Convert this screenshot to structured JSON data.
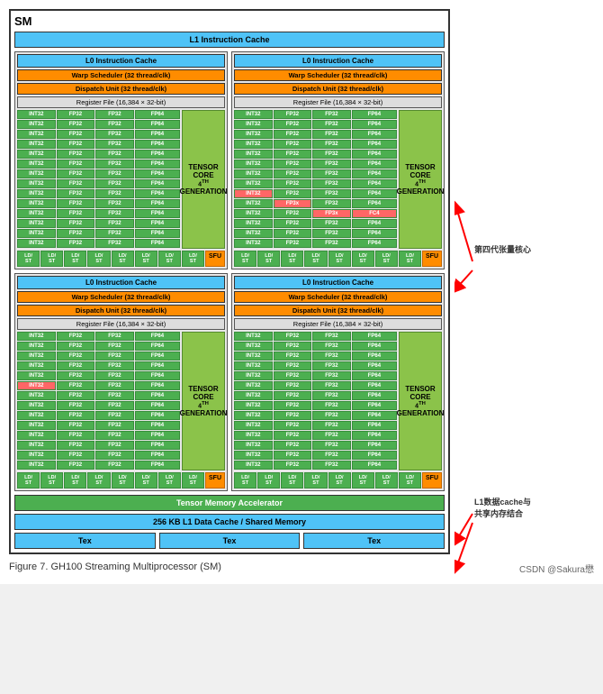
{
  "sm_title": "SM",
  "l1_cache": "L1 Instruction Cache",
  "quadrants": [
    {
      "l0_cache": "L0 Instruction Cache",
      "warp_scheduler": "Warp Scheduler (32 thread/clk)",
      "dispatch_unit": "Dispatch Unit (32 thread/clk)",
      "register_file": "Register File (16,384 × 32-bit)",
      "tensor_core": "TENSOR CORE",
      "generation": "4TH GENERATION"
    },
    {
      "l0_cache": "L0 Instruction Cache",
      "warp_scheduler": "Warp Scheduler (32 thread/clk)",
      "dispatch_unit": "Dispatch Unit (32 thread/clk)",
      "register_file": "Register File (16,384 × 32-bit)",
      "tensor_core": "TENSOR CORE",
      "generation": "4TH GENERATION"
    },
    {
      "l0_cache": "L0 Instruction Cache",
      "warp_scheduler": "Warp Scheduler (32 thread/clk)",
      "dispatch_unit": "Dispatch Unit (32 thread/clk)",
      "register_file": "Register File (16,384 × 32-bit)",
      "tensor_core": "TENSOR CORE",
      "generation": "4TH GENERATION"
    },
    {
      "l0_cache": "L0 Instruction Cache",
      "warp_scheduler": "Warp Scheduler (32 thread/clk)",
      "dispatch_unit": "Dispatch Unit (32 thread/clk)",
      "register_file": "Register File (16,384 × 32-bit)",
      "tensor_core": "TENSOR CORE",
      "generation": "4TH GENERATION"
    }
  ],
  "tensor_memory": "Tensor Memory Accelerator",
  "l1_data_cache": "256 KB L1 Data Cache / Shared Memory",
  "tex_label": "Tex",
  "sfu_label": "SFU",
  "ldst_label": "LD/ ST",
  "figure_caption": "Figure 7.    GH100 Streaming Multiprocessor (SM)",
  "annotation1": "第四代张量核心",
  "annotation2": "L1数据cache与\n共享内存结合",
  "csdn_credit": "CSDN @Sakura懋"
}
